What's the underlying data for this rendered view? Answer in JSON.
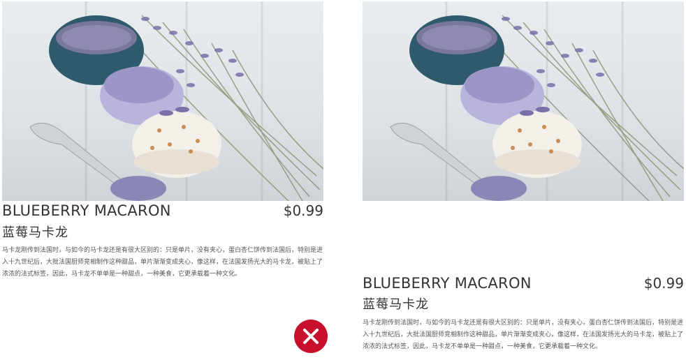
{
  "cards": [
    {
      "variant": "incorrect",
      "title": "BLUEBERRY MACARON",
      "price": "$0.99",
      "subtitle": "蓝莓马卡龙",
      "description": "马卡龙刚传到法国时，与如今的马卡龙还是有很大区别的：只是单片，没有夹心，蛋白杏仁饼传到法国后，特别是进入十九世纪后，大批法国厨师竞相制作这种甜品，单片渐渐变成夹心，像这样，在法国发扬光大的马卡龙，被贴上了浓浓的法式标签，因此，马卡龙不单单是一种甜点，一种美食，它更承载着一种文化。",
      "image_icon": "macaron-photo"
    },
    {
      "variant": "correct",
      "title": "BLUEBERRY MACARON",
      "price": "$0.99",
      "subtitle": "蓝莓马卡龙",
      "description": "马卡龙刚传到法国时，与如今的马卡龙还是有很大区别的：只是单片，没有夹心，蛋白杏仁饼传到法国后，特别是进入十九世纪后，大批法国厨师竞相制作这种甜品，单片渐渐变成夹心，像这样，在法国发扬光大的马卡龙，被贴上了浓浓的法式标签，因此，马卡龙不单单是一种甜点，一种美食，它更承载着一种文化。",
      "image_icon": "macaron-photo"
    }
  ],
  "reject_mark": {
    "icon": "close-icon",
    "color": "#c8102e"
  }
}
